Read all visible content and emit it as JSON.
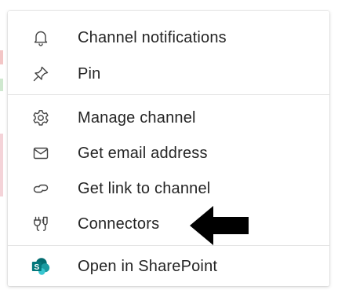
{
  "menu": {
    "items": [
      {
        "label": "Channel notifications",
        "icon": "bell-icon"
      },
      {
        "label": "Pin",
        "icon": "pin-icon"
      },
      {
        "label": "Manage channel",
        "icon": "gear-icon"
      },
      {
        "label": "Get email address",
        "icon": "envelope-icon"
      },
      {
        "label": "Get link to channel",
        "icon": "link-icon"
      },
      {
        "label": "Connectors",
        "icon": "connectors-icon"
      },
      {
        "label": "Open in SharePoint",
        "icon": "sharepoint-icon"
      }
    ]
  },
  "colors": {
    "text": "#242424",
    "icon": "#424242",
    "divider": "#e1e1e1",
    "sharepoint_dark": "#036c70",
    "sharepoint_mid": "#1a9ba1",
    "sharepoint_light": "#37c6d0",
    "annotation_arrow": "#000000"
  }
}
